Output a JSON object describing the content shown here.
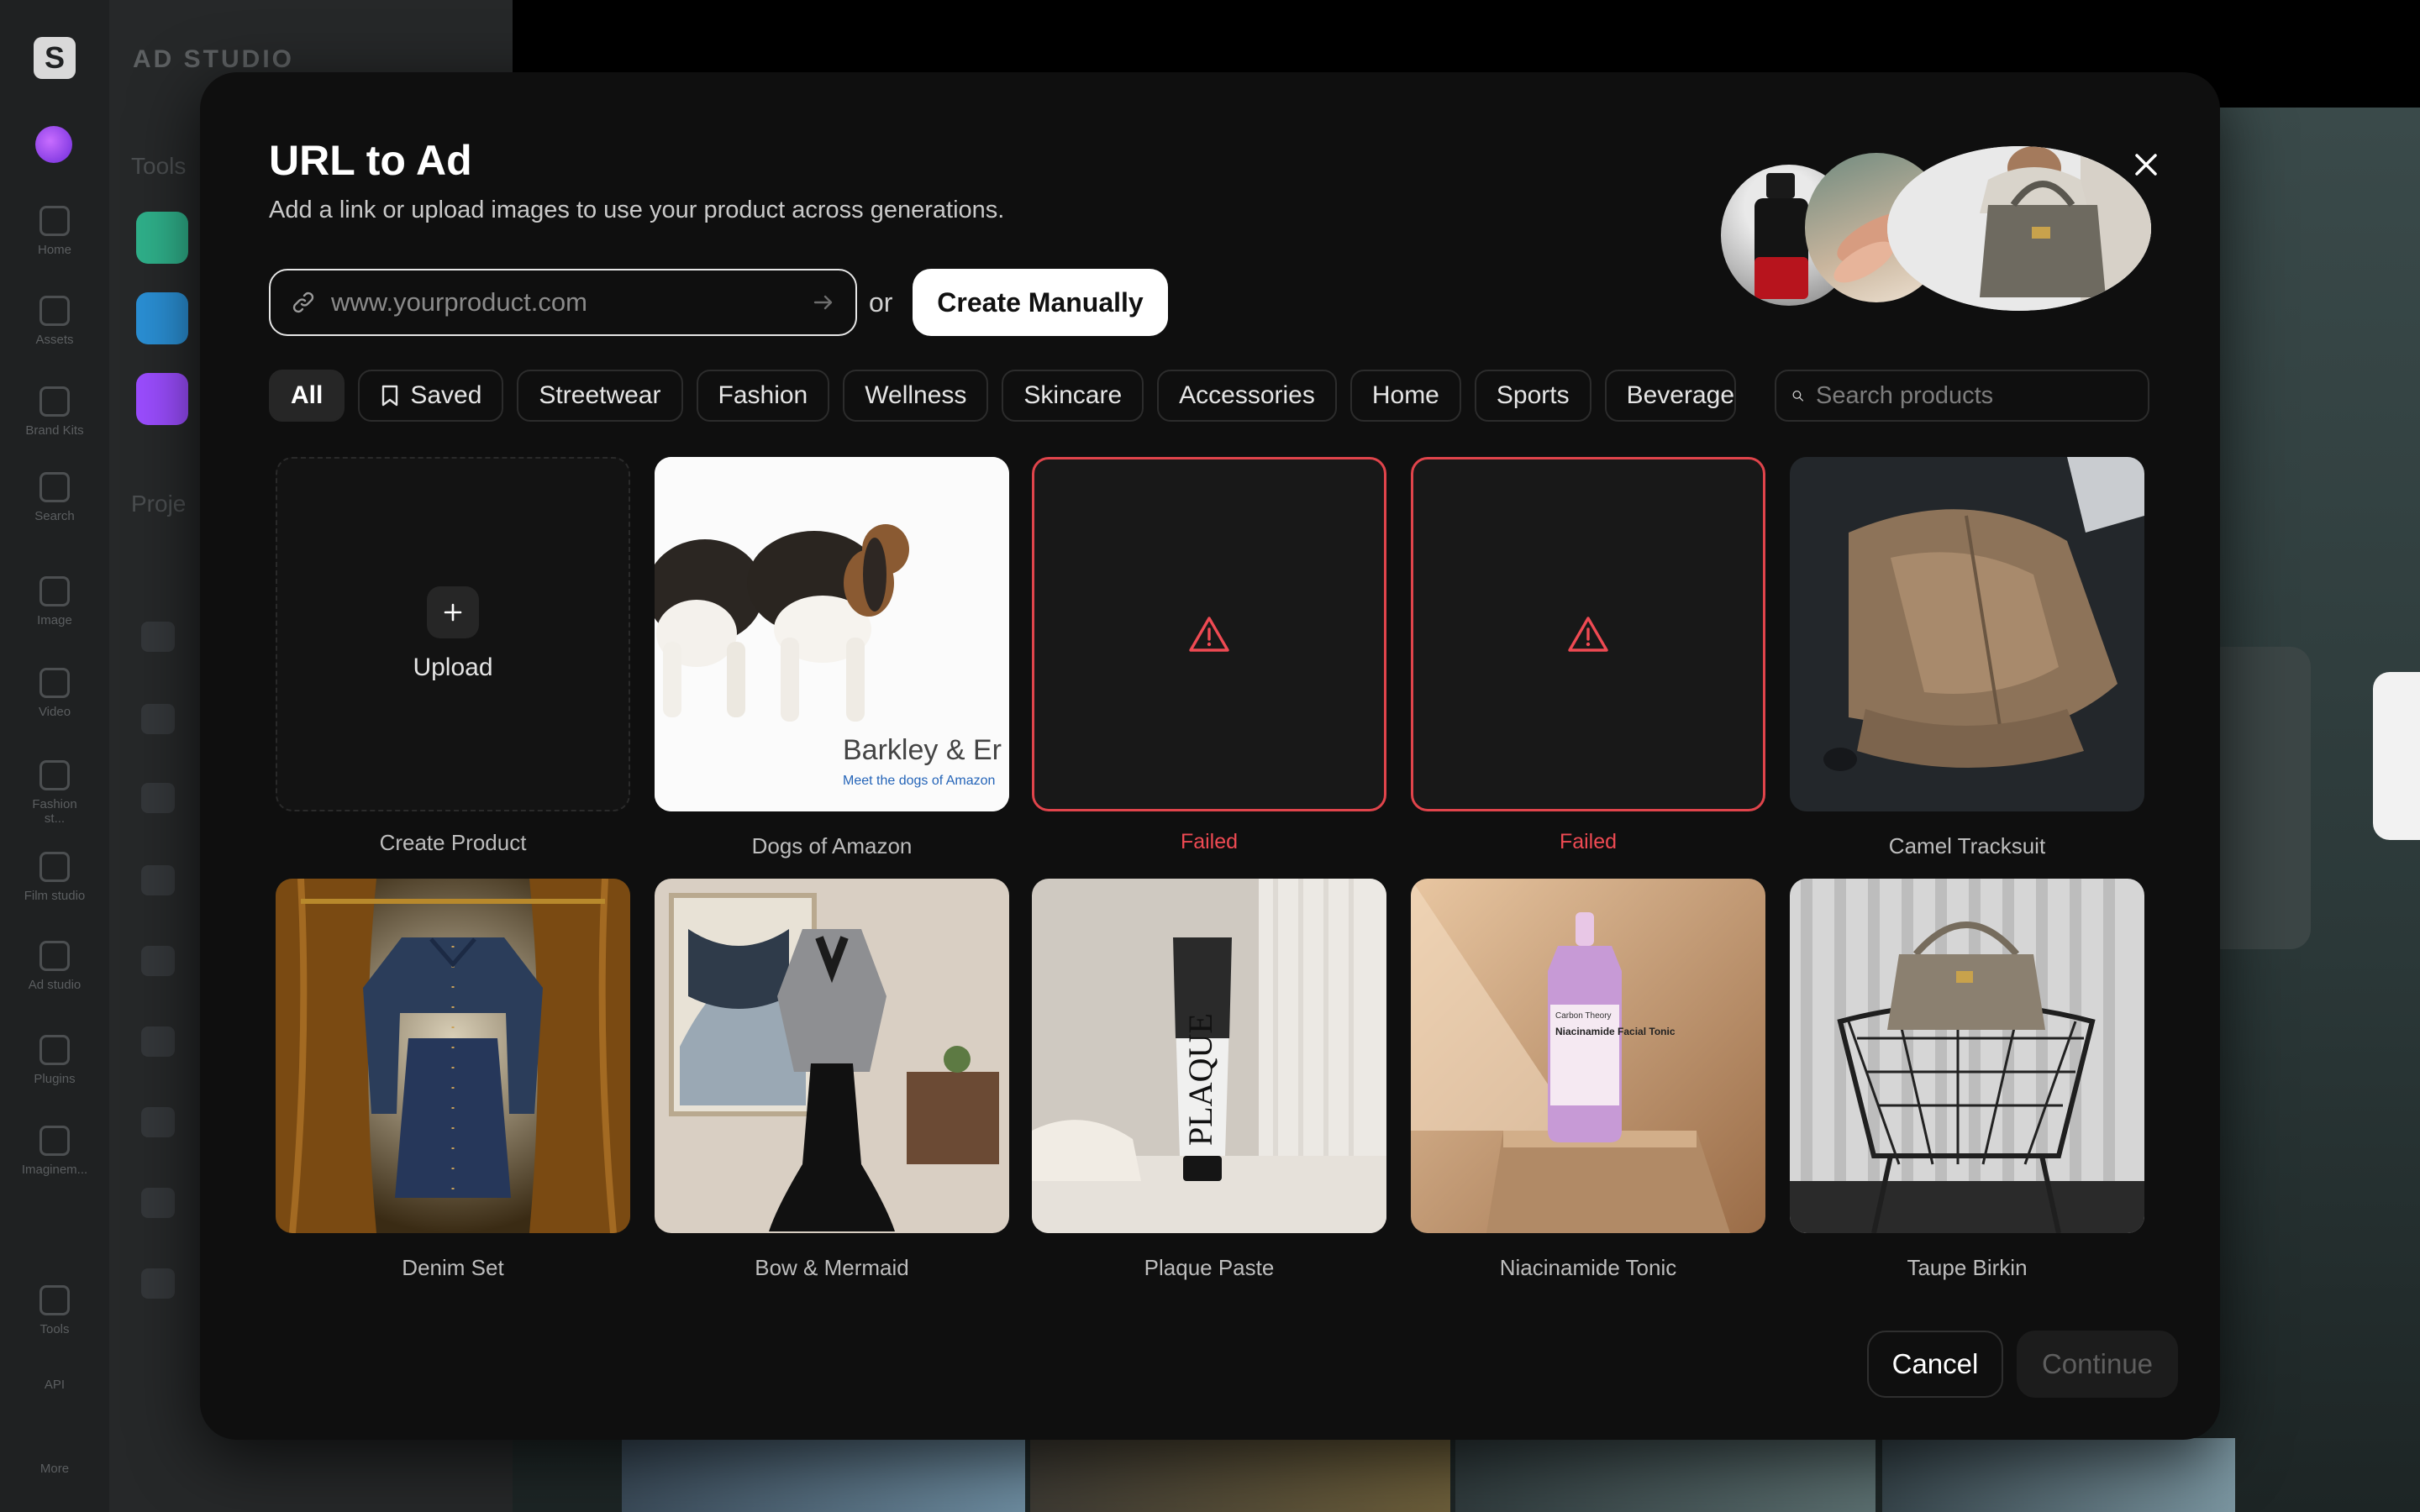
{
  "background": {
    "studio_title": "AD STUDIO",
    "tools_label": "Tools",
    "projects_label": "Proje",
    "rail_items": [
      "Home",
      "Assets",
      "Brand Kits",
      "Search",
      "Image",
      "Video",
      "Fashion st...",
      "Film studio",
      "Ad studio",
      "Plugins",
      "Imaginem...",
      "Tools",
      "API",
      "More"
    ]
  },
  "modal": {
    "title": "URL to Ad",
    "subtitle": "Add a link or upload images to use your product across generations.",
    "url_placeholder": "www.yourproduct.com",
    "or_label": "or",
    "create_manually_label": "Create Manually",
    "search_placeholder": "Search products",
    "cancel_label": "Cancel",
    "continue_label": "Continue"
  },
  "filters": [
    {
      "label": "All",
      "active": true
    },
    {
      "label": "Saved",
      "icon": "bookmark-icon"
    },
    {
      "label": "Streetwear"
    },
    {
      "label": "Fashion"
    },
    {
      "label": "Wellness"
    },
    {
      "label": "Skincare"
    },
    {
      "label": "Accessories"
    },
    {
      "label": "Home"
    },
    {
      "label": "Sports"
    },
    {
      "label": "Beverage"
    }
  ],
  "products": {
    "create": {
      "tile_label": "Upload",
      "caption": "Create Product"
    },
    "dogs": {
      "caption": "Dogs of Amazon",
      "brand_text": "Barkley & Er",
      "brand_tagline": "Meet the dogs of Amazon"
    },
    "failed_1": {
      "caption": "Failed"
    },
    "failed_2": {
      "caption": "Failed"
    },
    "camel": {
      "caption": "Camel Tracksuit"
    },
    "denim": {
      "caption": "Denim Set"
    },
    "bow": {
      "caption": "Bow & Mermaid"
    },
    "plaque": {
      "caption": "Plaque Paste",
      "tube_text": "PLAQUE"
    },
    "tonic": {
      "caption": "Niacinamide Tonic",
      "bottle_brand": "Carbon Theory",
      "bottle_text": "Niacinamide Facial Tonic"
    },
    "birkin": {
      "caption": "Taupe Birkin"
    }
  },
  "colors": {
    "accent_error": "#ef4a53",
    "modal_bg": "#0f0f0f"
  }
}
